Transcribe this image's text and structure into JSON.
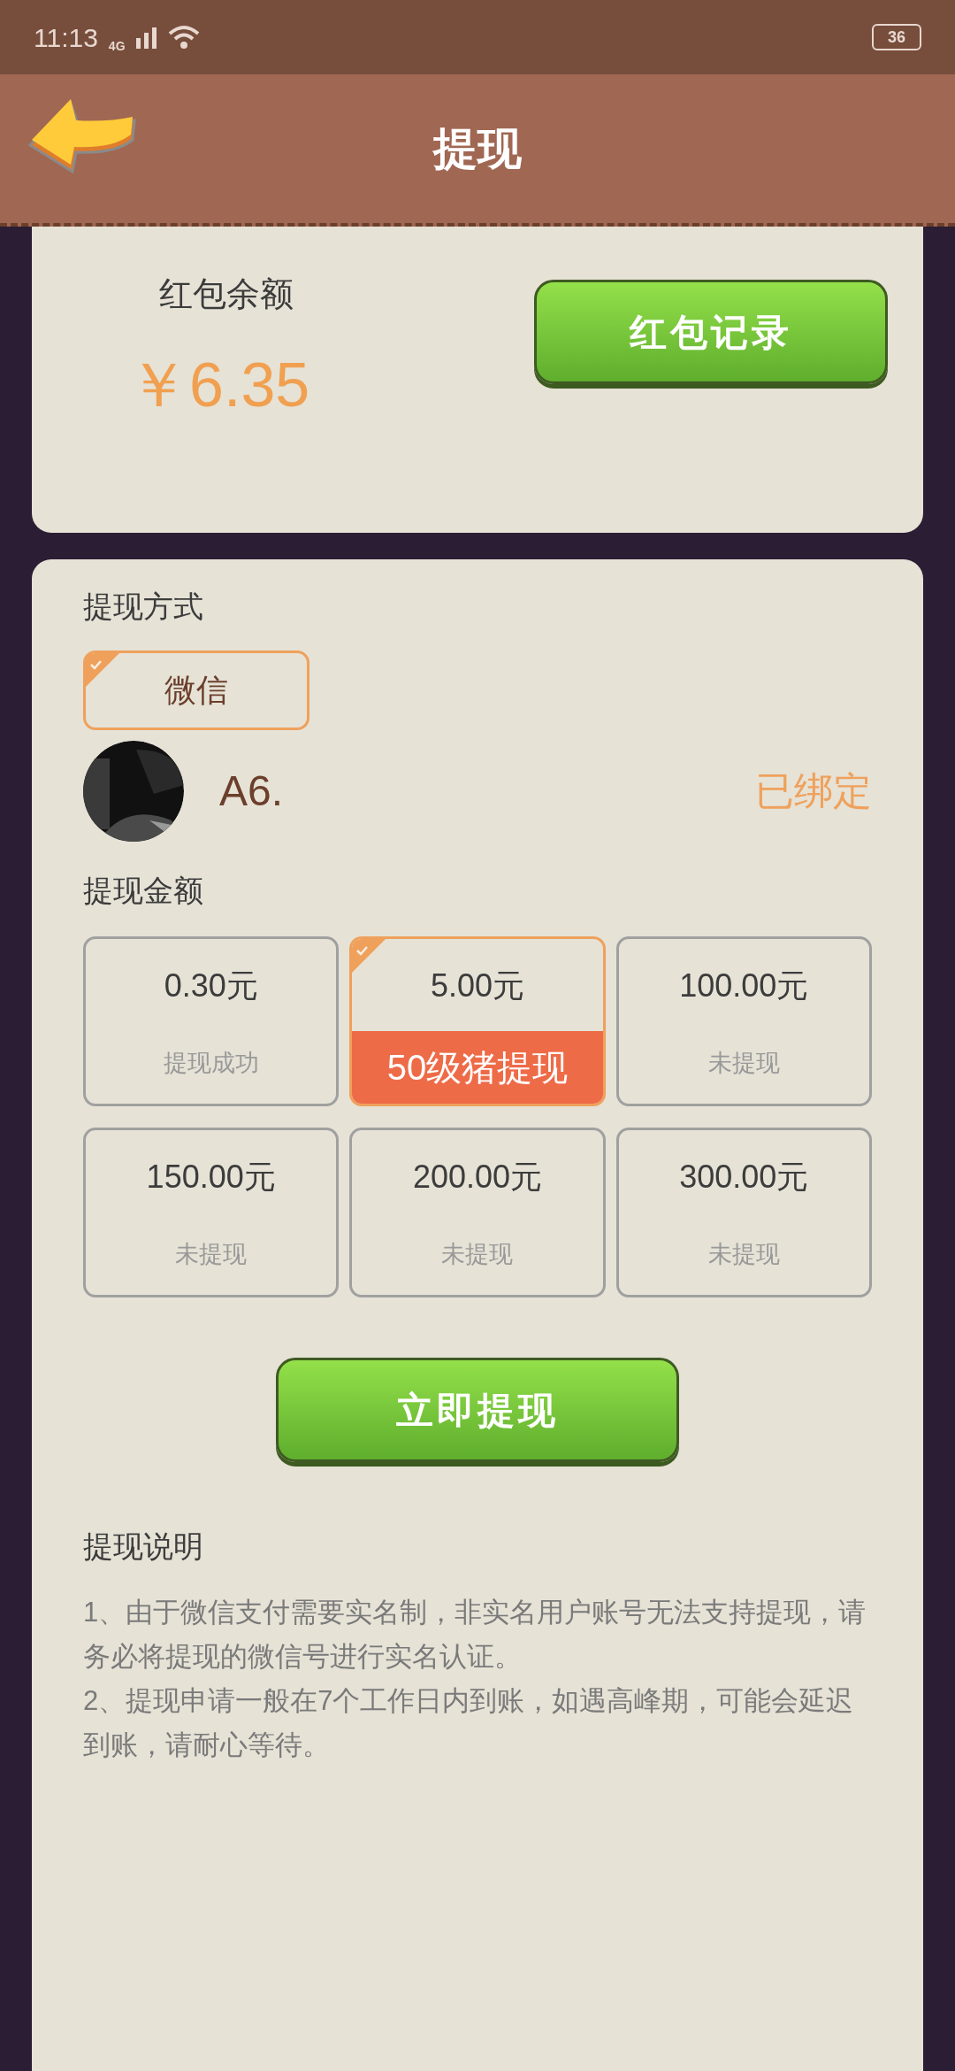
{
  "status_bar": {
    "time": "11:13",
    "network": "4G",
    "battery": "36"
  },
  "header": {
    "title": "提现"
  },
  "balance": {
    "label": "红包余额",
    "amount": "￥6.35",
    "record_button": "红包记录"
  },
  "method": {
    "title": "提现方式",
    "options": [
      {
        "label": "微信",
        "selected": true
      }
    ],
    "account": {
      "name": "A6.",
      "status": "已绑定"
    }
  },
  "amounts": {
    "title": "提现金额",
    "options": [
      {
        "amount": "0.30元",
        "status": "提现成功",
        "selected": false
      },
      {
        "amount": "5.00元",
        "badge": "50级猪提现",
        "selected": true
      },
      {
        "amount": "100.00元",
        "status": "未提现",
        "selected": false
      },
      {
        "amount": "150.00元",
        "status": "未提现",
        "selected": false
      },
      {
        "amount": "200.00元",
        "status": "未提现",
        "selected": false
      },
      {
        "amount": "300.00元",
        "status": "未提现",
        "selected": false
      }
    ]
  },
  "submit_button": "立即提现",
  "notes": {
    "title": "提现说明",
    "lines": [
      "1、由于微信支付需要实名制，非实名用户账号无法支持提现，请务必将提现的微信号进行实名认证。",
      "2、提现申请一般在7个工作日内到账，如遇高峰期，可能会延迟到账，请耐心等待。"
    ]
  }
}
